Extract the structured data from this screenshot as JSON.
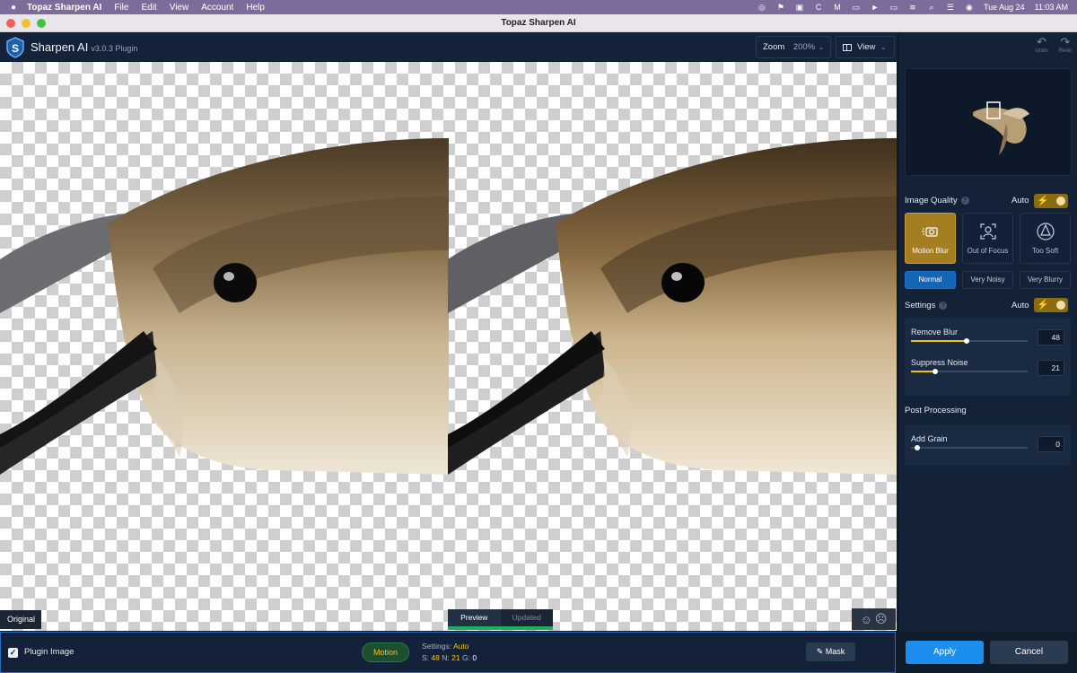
{
  "menubar": {
    "app_name": "Topaz Sharpen AI",
    "items": [
      "File",
      "Edit",
      "View",
      "Account",
      "Help"
    ],
    "date": "Tue Aug 24",
    "time": "11:03 AM"
  },
  "window": {
    "title": "Topaz Sharpen AI"
  },
  "header": {
    "app_title": "Sharpen AI",
    "version": "v3.0.3 Plugin",
    "zoom_label": "Zoom",
    "zoom_value": "200%",
    "view_label": "View"
  },
  "toolbar": {
    "undo_label": "Undo",
    "redo_label": "Redo"
  },
  "panel": {
    "image_quality": {
      "label": "Image Quality",
      "auto_label": "Auto",
      "auto_enabled": true,
      "modes": [
        "Motion Blur",
        "Out of Focus",
        "Too Soft"
      ],
      "selected_mode": "Motion Blur",
      "levels": [
        "Normal",
        "Very Noisy",
        "Very Blurry"
      ],
      "selected_level": "Normal"
    },
    "settings": {
      "label": "Settings",
      "auto_label": "Auto",
      "auto_enabled": true,
      "remove_blur": {
        "label": "Remove Blur",
        "value": 48
      },
      "suppress_noise": {
        "label": "Suppress Noise",
        "value": 21
      }
    },
    "post_processing": {
      "label": "Post Processing",
      "add_grain": {
        "label": "Add Grain",
        "value": 0
      }
    }
  },
  "canvas": {
    "original_label": "Original",
    "preview_tabs": [
      "Preview",
      "Updated"
    ],
    "active_preview_tab": "Preview"
  },
  "bottom": {
    "plugin_image_label": "Plugin Image",
    "plugin_image_checked": true,
    "mode_pill": "Motion",
    "settings_label": "Settings:",
    "settings_value": "Auto",
    "s_label": "S:",
    "s_value": "48",
    "n_label": "N:",
    "n_value": "21",
    "g_label": "G:",
    "g_value": "0",
    "mask_label": "Mask",
    "apply_label": "Apply",
    "cancel_label": "Cancel"
  },
  "colors": {
    "accent_blue": "#1b8ef0",
    "accent_gold": "#f5c20b",
    "panel_bg": "#142238",
    "preview_green": "#1fae5a"
  }
}
